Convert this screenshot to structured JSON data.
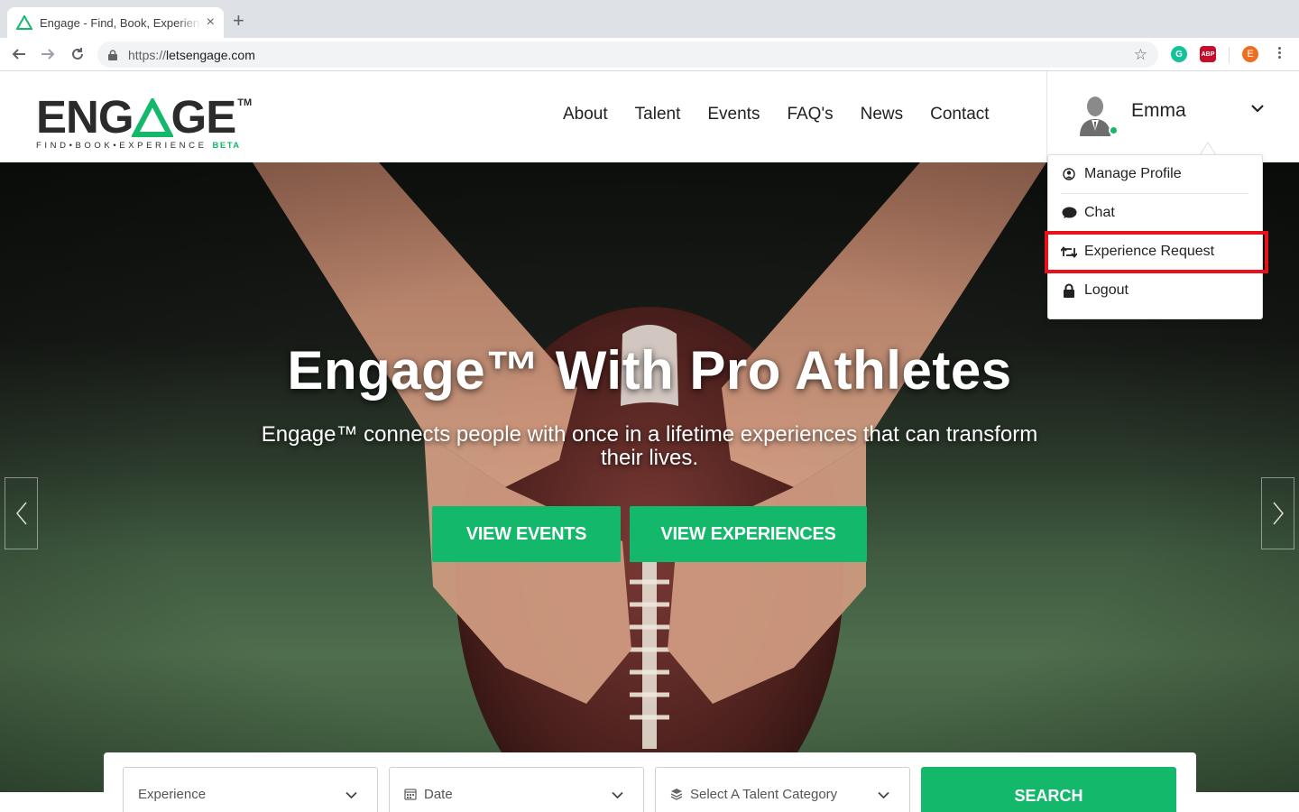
{
  "browser": {
    "tab_title": "Engage - Find, Book, Experience",
    "url_scheme": "https://",
    "url_host": "letsengage.com",
    "profile_initial": "E",
    "extensions": [
      "grammarly-icon",
      "adblock-plus-icon"
    ],
    "abp_label": "ABP"
  },
  "site": {
    "logo": {
      "word_left": "ENG",
      "word_right": "GE",
      "trademark": "TM",
      "tagline": "FIND•BOOK•EXPERIENCE",
      "beta": "BETA"
    },
    "nav": [
      "About",
      "Talent",
      "Events",
      "FAQ's",
      "News",
      "Contact"
    ],
    "user": {
      "name": "Emma",
      "online": true
    }
  },
  "dropdown": {
    "items": [
      {
        "label": "Manage Profile",
        "icon": "user-circle-icon"
      },
      {
        "label": "Chat",
        "icon": "chat-bubble-icon"
      },
      {
        "label": "Experience Request",
        "icon": "retweet-icon",
        "highlighted": true
      },
      {
        "label": "Logout",
        "icon": "lock-icon"
      }
    ]
  },
  "hero": {
    "title": "Engage™ With Pro Athletes",
    "subtitle": "Engage™ connects people with once in a lifetime experiences that can transform their lives.",
    "buttons": [
      "VIEW EVENTS",
      "VIEW EXPERIENCES"
    ]
  },
  "search": {
    "experience_placeholder": "Experience",
    "date_placeholder": "Date",
    "category_placeholder": "Select A Talent Category",
    "button": "SEARCH"
  },
  "colors": {
    "brand_green": "#14b86b",
    "highlight_red": "#e8101a",
    "text_dark": "#222222"
  }
}
